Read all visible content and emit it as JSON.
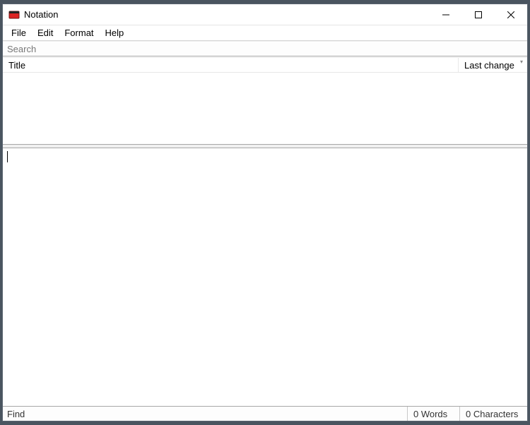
{
  "titlebar": {
    "title": "Notation"
  },
  "menubar": {
    "items": [
      "File",
      "Edit",
      "Format",
      "Help"
    ]
  },
  "search": {
    "placeholder": "Search",
    "value": ""
  },
  "list": {
    "columns": {
      "title": "Title",
      "last_change": "Last change"
    },
    "rows": []
  },
  "editor": {
    "content": ""
  },
  "statusbar": {
    "find_label": "Find",
    "words": "0 Words",
    "characters": "0 Characters"
  }
}
